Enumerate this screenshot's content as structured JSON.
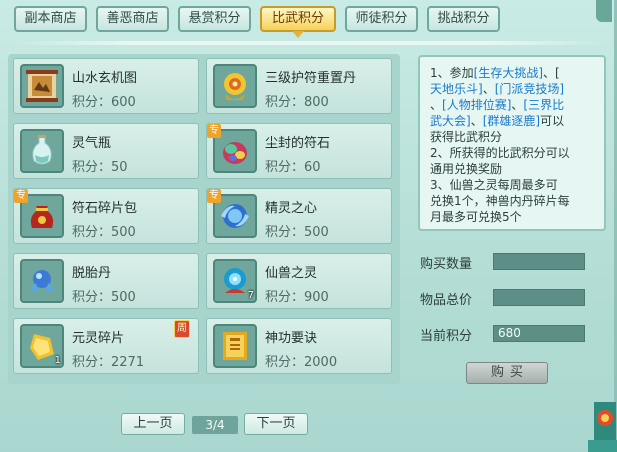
{
  "tabs": [
    {
      "label": "副本商店",
      "active": false
    },
    {
      "label": "善恶商店",
      "active": false
    },
    {
      "label": "悬赏积分",
      "active": false
    },
    {
      "label": "比武积分",
      "active": true
    },
    {
      "label": "师徒积分",
      "active": false
    },
    {
      "label": "挑战积分",
      "active": false
    }
  ],
  "points_prefix": "积分：",
  "items": [
    {
      "name": "山水玄机图",
      "points": "600",
      "icon": "scroll-map-icon",
      "tag": "",
      "count": "",
      "week": ""
    },
    {
      "name": "三级护符重置丹",
      "points": "800",
      "icon": "golden-pill-icon",
      "tag": "",
      "count": "",
      "week": ""
    },
    {
      "name": "灵气瓶",
      "points": "50",
      "icon": "spirit-vase-icon",
      "tag": "",
      "count": "",
      "week": ""
    },
    {
      "name": "尘封的符石",
      "points": "60",
      "icon": "rune-stone-icon",
      "tag": "专",
      "count": "",
      "week": ""
    },
    {
      "name": "符石碎片包",
      "points": "500",
      "icon": "fragment-bag-icon",
      "tag": "专",
      "count": "",
      "week": ""
    },
    {
      "name": "精灵之心",
      "points": "500",
      "icon": "spirit-heart-icon",
      "tag": "专",
      "count": "",
      "week": ""
    },
    {
      "name": "脱胎丹",
      "points": "500",
      "icon": "rebirth-pill-icon",
      "tag": "",
      "count": "",
      "week": ""
    },
    {
      "name": "仙兽之灵",
      "points": "900",
      "icon": "beast-spirit-icon",
      "tag": "",
      "count": "7",
      "week": ""
    },
    {
      "name": "元灵碎片",
      "points": "2271",
      "icon": "soul-shard-icon",
      "tag": "",
      "count": "1",
      "week": "周"
    },
    {
      "name": "神功要诀",
      "points": "2000",
      "icon": "skill-book-icon",
      "tag": "",
      "count": "",
      "week": ""
    }
  ],
  "pager": {
    "prev": "上一页",
    "page": "3/4",
    "next": "下一页"
  },
  "info": {
    "line1_a": "1、参加",
    "line1_b": "[生存大挑战]",
    "line1_c": "、[",
    "line2_a": "天地乐斗]",
    "line2_b": "、",
    "line2_c": "[门派竞技场]",
    "line3_a": "、",
    "line3_b": "[人物排位赛]",
    "line3_c": "、",
    "line3_d": "[三界比",
    "line4_a": "武大会]",
    "line4_b": "、",
    "line4_c": "[群雄逐鹿]",
    "line4_d": "可以",
    "line5": "获得比武积分",
    "line6": "2、所获得的比武积分可以",
    "line7": "通用兑换奖励",
    "line8": "3、仙兽之灵每周最多可",
    "line9": "兑换1个，神兽内丹碎片每",
    "line10": "月最多可兑换5个"
  },
  "purchase": {
    "qty_label": "购买数量",
    "qty_value": "",
    "total_label": "物品总价",
    "total_value": "",
    "current_label": "当前积分",
    "current_value": "680",
    "buy_label": "购买"
  },
  "colors": {
    "accent": "#f6d25a",
    "link": "#1a7acb",
    "panel": "#a7d4cc"
  }
}
